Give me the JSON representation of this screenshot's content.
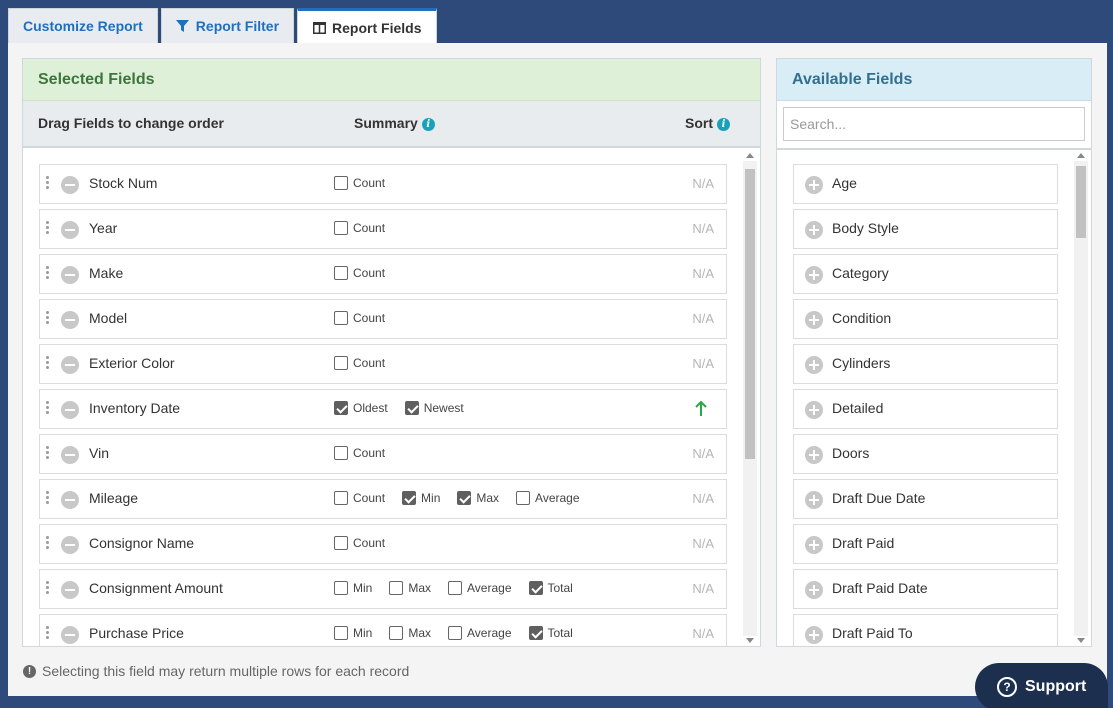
{
  "tabs": [
    {
      "label": "Customize Report",
      "icon": "none",
      "active": false
    },
    {
      "label": "Report Filter",
      "icon": "filter-icon",
      "active": false
    },
    {
      "label": "Report Fields",
      "icon": "columns-icon",
      "active": true
    }
  ],
  "selected": {
    "title": "Selected Fields",
    "col_drag": "Drag Fields to change order",
    "col_summary": "Summary",
    "col_sort": "Sort",
    "rows": [
      {
        "name": "Stock Num",
        "summary": [
          {
            "label": "Count",
            "checked": false
          }
        ],
        "sort": "N/A"
      },
      {
        "name": "Year",
        "summary": [
          {
            "label": "Count",
            "checked": false
          }
        ],
        "sort": "N/A"
      },
      {
        "name": "Make",
        "summary": [
          {
            "label": "Count",
            "checked": false
          }
        ],
        "sort": "N/A"
      },
      {
        "name": "Model",
        "summary": [
          {
            "label": "Count",
            "checked": false
          }
        ],
        "sort": "N/A"
      },
      {
        "name": "Exterior Color",
        "summary": [
          {
            "label": "Count",
            "checked": false
          }
        ],
        "sort": "N/A"
      },
      {
        "name": "Inventory Date",
        "summary": [
          {
            "label": "Oldest",
            "checked": true
          },
          {
            "label": "Newest",
            "checked": true
          }
        ],
        "sort": "arrow-up"
      },
      {
        "name": "Vin",
        "summary": [
          {
            "label": "Count",
            "checked": false
          }
        ],
        "sort": "N/A"
      },
      {
        "name": "Mileage",
        "summary": [
          {
            "label": "Count",
            "checked": false
          },
          {
            "label": "Min",
            "checked": true
          },
          {
            "label": "Max",
            "checked": true
          },
          {
            "label": "Average",
            "checked": false
          }
        ],
        "sort": "N/A"
      },
      {
        "name": "Consignor Name",
        "summary": [
          {
            "label": "Count",
            "checked": false
          }
        ],
        "sort": "N/A"
      },
      {
        "name": "Consignment Amount",
        "summary": [
          {
            "label": "Min",
            "checked": false
          },
          {
            "label": "Max",
            "checked": false
          },
          {
            "label": "Average",
            "checked": false
          },
          {
            "label": "Total",
            "checked": true
          }
        ],
        "sort": "N/A"
      },
      {
        "name": "Purchase Price",
        "summary": [
          {
            "label": "Min",
            "checked": false
          },
          {
            "label": "Max",
            "checked": false
          },
          {
            "label": "Average",
            "checked": false
          },
          {
            "label": "Total",
            "checked": true
          }
        ],
        "sort": "N/A"
      }
    ]
  },
  "available": {
    "title": "Available Fields",
    "search_placeholder": "Search...",
    "items": [
      "Age",
      "Body Style",
      "Category",
      "Condition",
      "Cylinders",
      "Detailed",
      "Doors",
      "Draft Due Date",
      "Draft Paid",
      "Draft Paid Date",
      "Draft Paid To"
    ]
  },
  "note": "Selecting this field may return multiple rows for each record",
  "support_label": "Support",
  "colors": {
    "accent": "#1f6fbf",
    "selected_header": "#dff0d8",
    "available_header": "#d9edf7",
    "sort_arrow": "#28a745"
  }
}
